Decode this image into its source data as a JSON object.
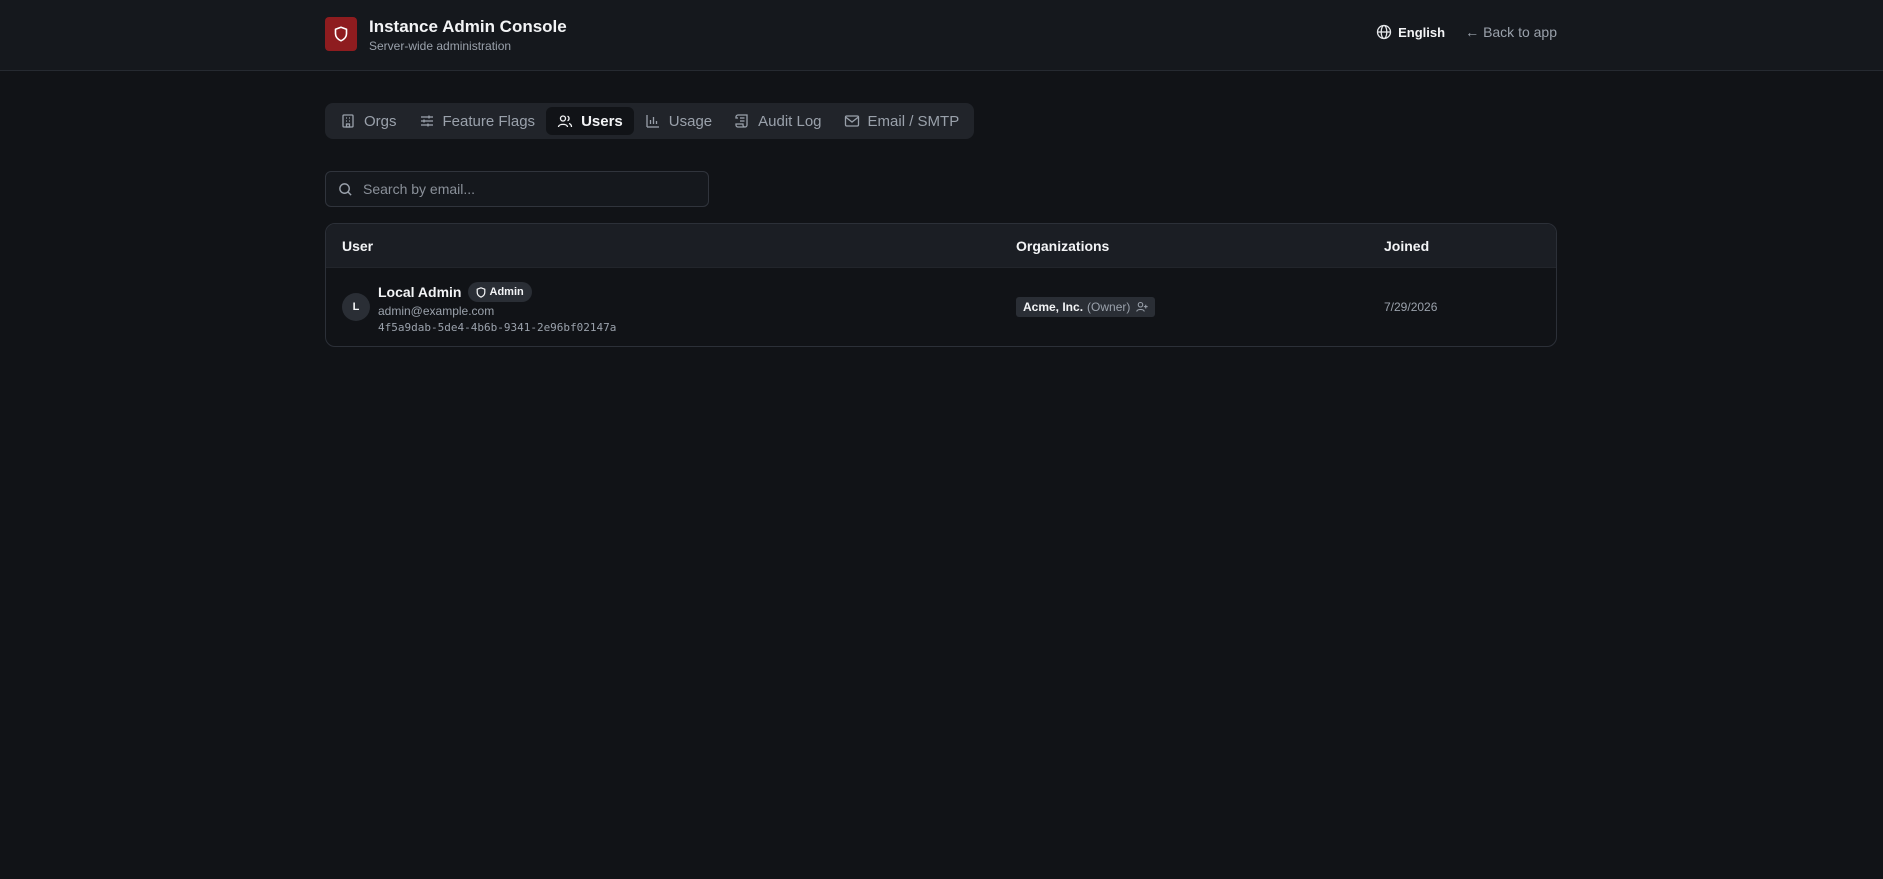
{
  "header": {
    "title": "Instance Admin Console",
    "subtitle": "Server-wide administration",
    "language": "English",
    "back_arrow": "←",
    "back_label": "Back to app"
  },
  "tabs": [
    {
      "label": "Orgs",
      "icon": "building-icon",
      "active": false
    },
    {
      "label": "Feature Flags",
      "icon": "sliders-icon",
      "active": false
    },
    {
      "label": "Users",
      "icon": "users-icon",
      "active": true
    },
    {
      "label": "Usage",
      "icon": "bar-chart-icon",
      "active": false
    },
    {
      "label": "Audit Log",
      "icon": "scroll-icon",
      "active": false
    },
    {
      "label": "Email / SMTP",
      "icon": "mail-icon",
      "active": false
    }
  ],
  "search": {
    "placeholder": "Search by email...",
    "value": ""
  },
  "table": {
    "columns": [
      "User",
      "Organizations",
      "Joined"
    ],
    "rows": [
      {
        "avatar": "L",
        "name": "Local Admin",
        "badge": "Admin",
        "email": "admin@example.com",
        "id": "4f5a9dab-5de4-4b6b-9341-2e96bf02147a",
        "org_name": "Acme, Inc.",
        "org_role": "(Owner)",
        "joined": "7/29/2026"
      }
    ]
  },
  "colors": {
    "background": "#111317",
    "brand": "#8e1c1f",
    "surface": "#21242a"
  }
}
